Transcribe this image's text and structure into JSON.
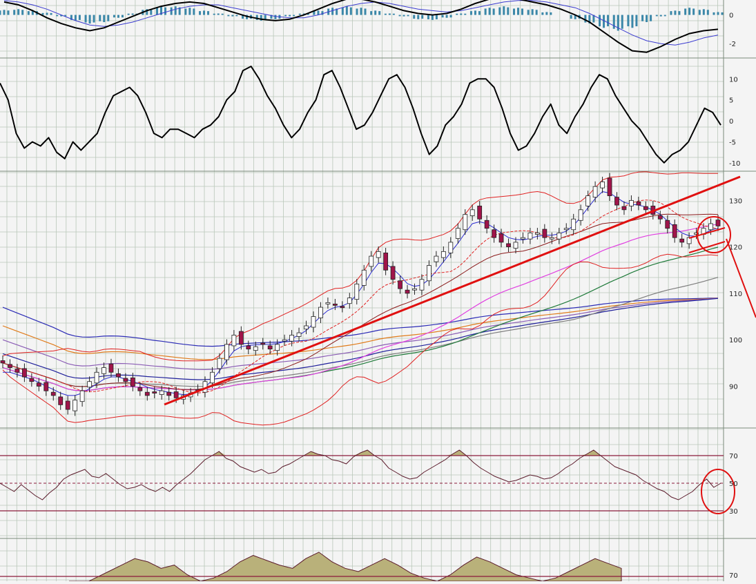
{
  "chart_data": [
    {
      "panel": "macd",
      "type": "bar",
      "yticks": [
        0,
        -2
      ],
      "ylim": [
        -3,
        2
      ],
      "histogram": [
        0.35,
        0.4,
        0.3,
        0.15,
        -0.1,
        -0.4,
        -0.6,
        -0.5,
        -0.2,
        0.1,
        0.4,
        0.6,
        0.6,
        0.5,
        0.3,
        0.1,
        -0.1,
        -0.3,
        -0.4,
        -0.3,
        -0.1,
        0.1,
        0.3,
        0.5,
        0.6,
        0.5,
        0.3,
        0.1,
        -0.1,
        -0.3,
        -0.35,
        -0.2,
        0.1,
        0.3,
        0.5,
        0.6,
        0.5,
        0.4,
        0.2,
        0.0,
        -0.3,
        -0.6,
        -0.9,
        -1.1,
        -0.9,
        -0.5,
        -0.1,
        0.3,
        0.5,
        0.4,
        0.2
      ],
      "macd_line": [
        0.9,
        0.7,
        0.3,
        -0.2,
        -0.6,
        -0.9,
        -1.1,
        -0.9,
        -0.5,
        -0.1,
        0.3,
        0.6,
        0.8,
        0.9,
        0.8,
        0.5,
        0.2,
        -0.1,
        -0.3,
        -0.4,
        -0.3,
        0.0,
        0.4,
        0.8,
        1.1,
        1.1,
        0.9,
        0.6,
        0.3,
        0.1,
        0.0,
        0.1,
        0.4,
        0.8,
        1.1,
        1.2,
        1.1,
        0.9,
        0.7,
        0.4,
        0.0,
        -0.5,
        -1.2,
        -1.9,
        -2.5,
        -2.6,
        -2.2,
        -1.7,
        -1.3,
        -1.1,
        -1.0
      ],
      "signal_line": [
        1.0,
        0.9,
        0.7,
        0.4,
        0.0,
        -0.4,
        -0.7,
        -0.8,
        -0.7,
        -0.5,
        -0.2,
        0.1,
        0.4,
        0.6,
        0.7,
        0.7,
        0.5,
        0.3,
        0.1,
        -0.1,
        -0.2,
        -0.2,
        0.0,
        0.3,
        0.6,
        0.8,
        0.9,
        0.8,
        0.6,
        0.4,
        0.3,
        0.2,
        0.3,
        0.5,
        0.7,
        0.9,
        1.0,
        1.0,
        0.9,
        0.7,
        0.5,
        0.1,
        -0.4,
        -0.9,
        -1.4,
        -1.8,
        -2.0,
        -2.1,
        -1.9,
        -1.6,
        -1.4
      ]
    },
    {
      "panel": "momentum",
      "type": "line",
      "yticks": [
        10,
        5,
        0,
        -5,
        -10
      ],
      "ylim": [
        -12,
        14
      ],
      "values": [
        9,
        5,
        -3,
        -6.5,
        -5,
        -6,
        -4,
        -7.5,
        -9,
        -5,
        -7,
        -5,
        -3,
        2,
        6,
        7,
        8,
        6,
        2,
        -3,
        -4,
        -2,
        -2,
        -3,
        -4,
        -2,
        -1,
        1,
        5,
        7,
        12,
        13,
        10,
        6,
        3,
        -1,
        -4,
        -2,
        2,
        5,
        11,
        12,
        8,
        3,
        -2,
        -1,
        2,
        6,
        10,
        11,
        8,
        3,
        -3,
        -8,
        -6,
        -1,
        1,
        4,
        9,
        10,
        10,
        8,
        3,
        -3,
        -7,
        -6,
        -3,
        1,
        4,
        -1,
        -3,
        1,
        4,
        8,
        11,
        10,
        6,
        3,
        0,
        -2,
        -5,
        -8,
        -10,
        -8,
        -7,
        -5,
        -1,
        3,
        2,
        -1
      ],
      "title": "",
      "xlabel": "",
      "ylabel": ""
    },
    {
      "panel": "price",
      "type": "candlestick",
      "yticks": [
        130,
        120,
        110,
        100,
        90
      ],
      "ylim": [
        81,
        136
      ],
      "close": [
        95,
        94,
        93,
        92,
        91,
        90,
        89,
        88,
        86,
        85,
        87,
        89,
        91,
        93,
        94,
        93,
        92,
        91,
        90,
        89,
        88,
        88.5,
        89,
        88,
        87.5,
        88,
        88.5,
        89,
        91,
        93,
        96,
        99,
        101,
        99,
        98,
        98.5,
        99,
        98,
        99,
        100,
        101,
        101.5,
        103,
        105,
        107,
        108,
        107.5,
        107,
        109,
        112,
        115,
        118,
        119,
        115,
        113,
        111,
        110,
        111,
        113,
        116,
        118,
        119,
        121,
        124,
        127,
        128,
        126,
        124,
        122,
        121,
        120,
        121,
        122,
        123,
        123,
        122,
        122,
        123,
        124,
        126,
        128,
        131,
        133,
        134,
        131,
        129,
        128,
        130,
        129,
        128,
        127,
        126,
        124,
        122,
        121,
        122,
        123,
        124,
        125,
        124.5
      ],
      "ma_fast": [
        93,
        93,
        92.5,
        92,
        91.5,
        90.8,
        90,
        89.3,
        88.5,
        88,
        88,
        88.5,
        89.5,
        90.5,
        91.5,
        92,
        92,
        91.5,
        91,
        90.5,
        89.8,
        89.3,
        89,
        88.7,
        88.4,
        88.2,
        88.3,
        88.8,
        89.8,
        91.3,
        93.3,
        95.6,
        97.6,
        98.5,
        98.8,
        98.9,
        99,
        99,
        99.2,
        99.6,
        100.3,
        101,
        102,
        103.5,
        105,
        106.3,
        107,
        107.3,
        108,
        109.8,
        112,
        114.5,
        116.5,
        116.4,
        115.3,
        113.8,
        112.1,
        111.5,
        111.8,
        113,
        114.8,
        116.8,
        118.8,
        120.8,
        123,
        125,
        125.4,
        125,
        124.1,
        123,
        122,
        121.6,
        121.5,
        121.8,
        122.3,
        122.5,
        122.5,
        122.8,
        123.4,
        124.6,
        126.4,
        128.4,
        130.4,
        131.9,
        131.6,
        130.6,
        129.6,
        129.2,
        129,
        128.6,
        127.9,
        127,
        125.6,
        124.2,
        123,
        122.4,
        122.3,
        122.8,
        123.6,
        124
      ]
    },
    {
      "panel": "rsi",
      "type": "area",
      "yticks": [
        70,
        50,
        30
      ],
      "ylim": [
        20,
        80
      ],
      "values": [
        50,
        47,
        44,
        49,
        45,
        41,
        38,
        43,
        47,
        53,
        56,
        58,
        60,
        55,
        54,
        57,
        53,
        49,
        46,
        47,
        49,
        46,
        44,
        47,
        44,
        49,
        53,
        57,
        62,
        67,
        70,
        73,
        68,
        66,
        62,
        60,
        58,
        60,
        57,
        58,
        62,
        64,
        67,
        70,
        73,
        71,
        70,
        67,
        66,
        64,
        69,
        72,
        74,
        70,
        67,
        61,
        58,
        55,
        53,
        54,
        58,
        61,
        64,
        67,
        71,
        74,
        70,
        65,
        61,
        58,
        55,
        53,
        51,
        52,
        54,
        56,
        55,
        53,
        54,
        57,
        61,
        64,
        68,
        71,
        74,
        70,
        66,
        62,
        60,
        58,
        56,
        52,
        49,
        46,
        44,
        40,
        38,
        41,
        44,
        49,
        53,
        47,
        50
      ],
      "annotation_band": [
        30,
        70
      ]
    },
    {
      "panel": "lower_rsi",
      "type": "area",
      "yticks": [
        70
      ],
      "values": [
        60,
        58,
        62,
        66,
        70,
        74,
        72,
        68,
        70,
        64,
        60,
        62,
        66,
        72,
        76,
        73,
        70,
        68,
        74,
        78,
        72,
        68,
        66,
        70,
        74,
        70,
        65,
        62,
        60,
        64,
        70,
        75,
        72,
        68,
        64,
        62,
        60,
        62,
        66,
        70,
        74,
        71,
        68
      ]
    }
  ]
}
